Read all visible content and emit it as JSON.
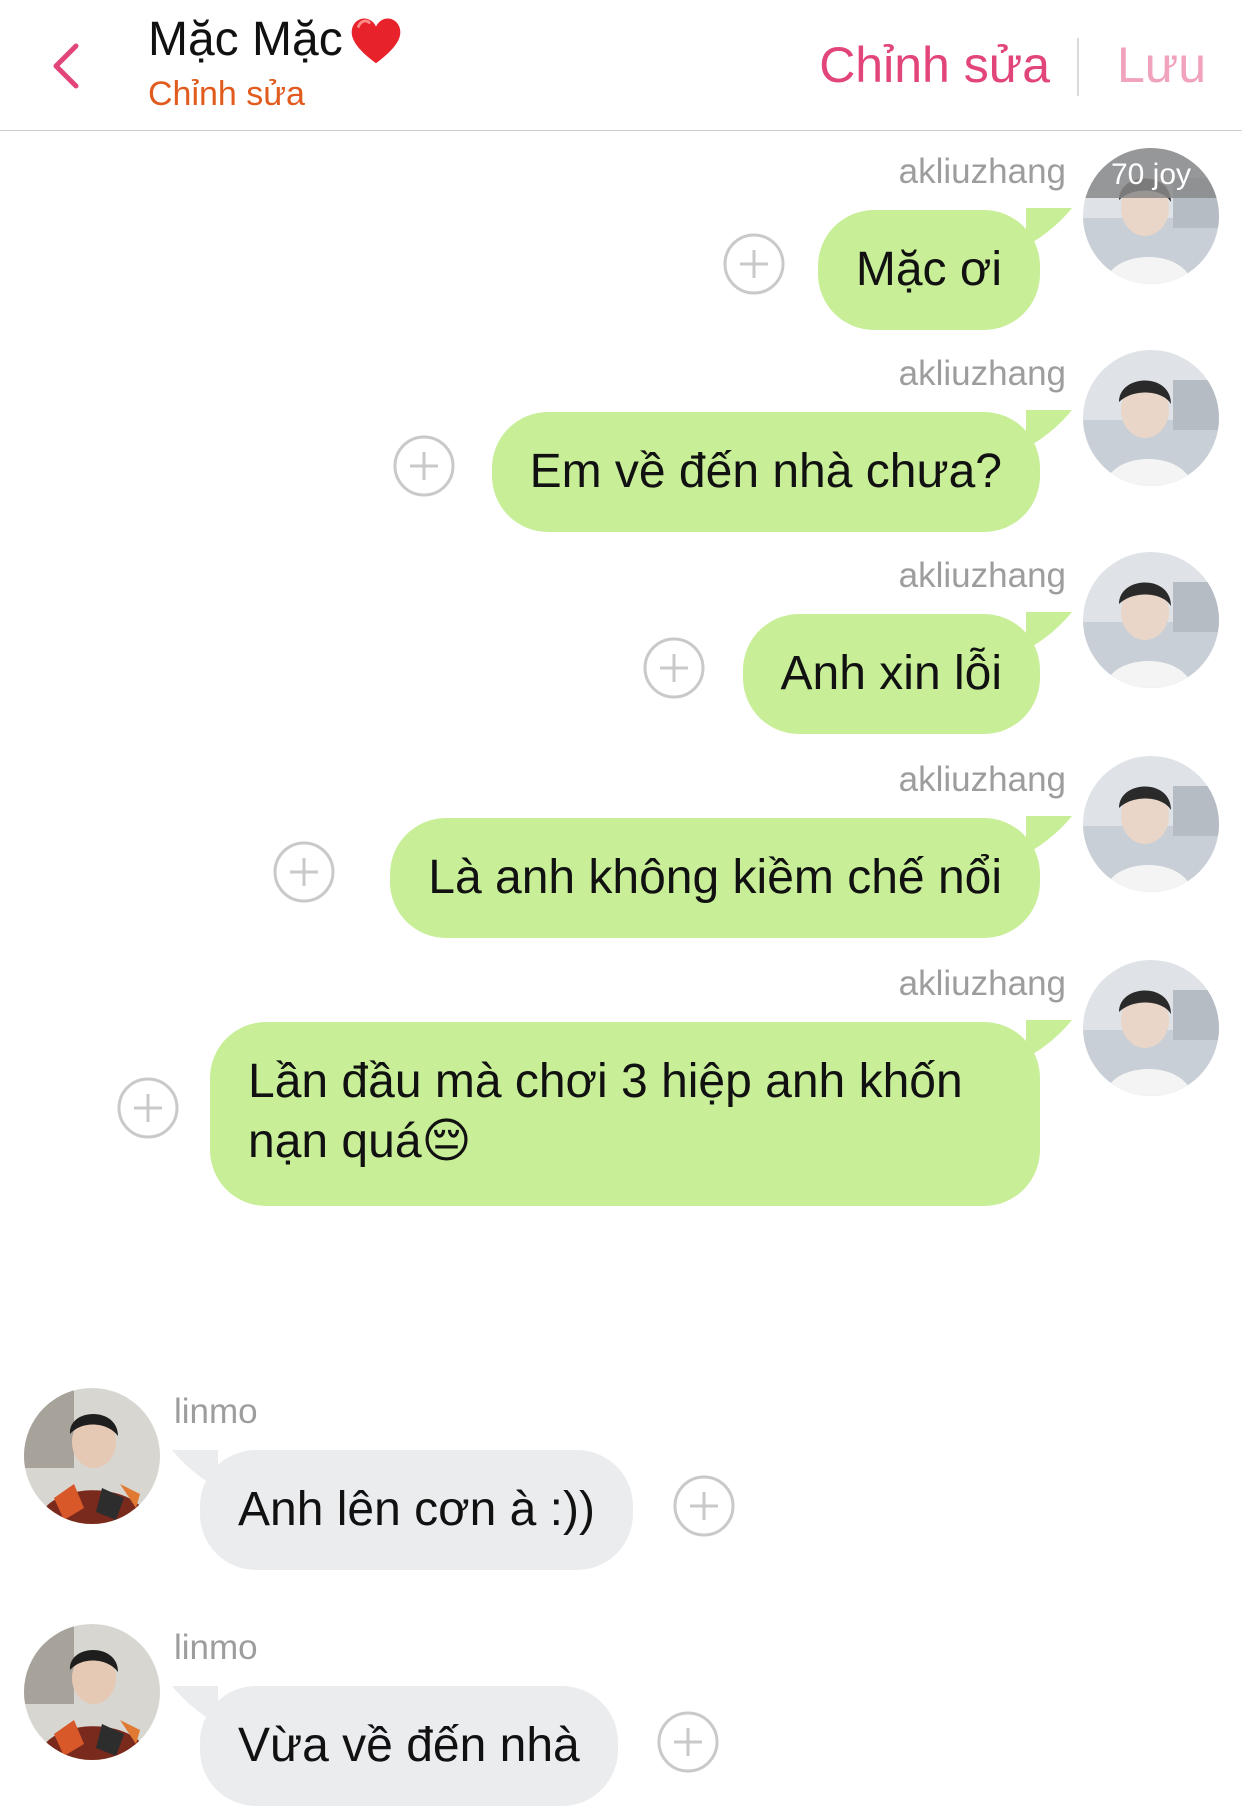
{
  "header": {
    "title": "Mặc Mặc",
    "subtitle": "Chỉnh sửa",
    "edit_label": "Chỉnh sửa",
    "save_label": "Lưu",
    "accent_color": "#e2457a",
    "subtitle_color": "#e15a1e"
  },
  "avatar_watermark": "70 joy",
  "messages": [
    {
      "side": "right",
      "username": "akliuzhang",
      "text": "Mặc ơi"
    },
    {
      "side": "right",
      "username": "akliuzhang",
      "text": "Em về đến nhà chưa?"
    },
    {
      "side": "right",
      "username": "akliuzhang",
      "text": "Anh xin lỗi"
    },
    {
      "side": "right",
      "username": "akliuzhang",
      "text": "Là anh không kiềm chế nổi"
    },
    {
      "side": "right",
      "username": "akliuzhang",
      "text": "Lần đầu mà chơi 3 hiệp anh khốn nạn quá😔"
    },
    {
      "side": "left",
      "username": "linmo",
      "text": "Anh lên cơn à :))"
    },
    {
      "side": "left",
      "username": "linmo",
      "text": "Vừa về đến nhà"
    }
  ],
  "colors": {
    "sent_bubble": "#c8ee98",
    "received_bubble": "#eaecee",
    "username": "#9d9d9d"
  },
  "icons": {
    "back": "chevron-left-icon",
    "heart": "red-heart-icon",
    "add": "circle-plus-icon"
  }
}
